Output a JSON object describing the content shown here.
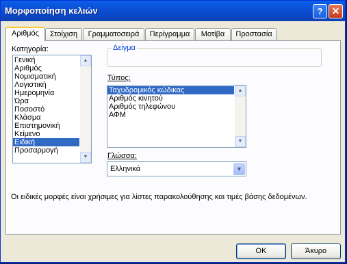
{
  "window": {
    "title": "Μορφοποίηση κελιών",
    "help_glyph": "?",
    "close_glyph": "✕"
  },
  "tabs": [
    {
      "label": "Αριθμός",
      "active": true
    },
    {
      "label": "Στοίχιση"
    },
    {
      "label": "Γραμματοσειρά"
    },
    {
      "label": "Περίγραμμα"
    },
    {
      "label": "Μοτίβα"
    },
    {
      "label": "Προστασία"
    }
  ],
  "category": {
    "label": "Κατηγορία:",
    "items": [
      "Γενική",
      "Αριθμός",
      "Νομισματική",
      "Λογιστική",
      "Ημερομηνία",
      "Ώρα",
      "Ποσοστό",
      "Κλάσμα",
      "Επιστημονική",
      "Κείμενο",
      "Ειδική",
      "Προσαρμογή"
    ],
    "selected_index": 10
  },
  "sample": {
    "legend": "Δείγμα"
  },
  "type": {
    "label": "Τύπος:",
    "items": [
      "Ταχυδρομικός κώδικας",
      "Αριθμός κινητού",
      "Αριθμός τηλεφώνου",
      "ΑΦΜ"
    ],
    "selected_index": 0
  },
  "language": {
    "label": "Γλώσσα:",
    "value": "Ελληνικά"
  },
  "description": "Οι ειδικές μορφές είναι χρήσιμες για λίστες παρακολούθησης και τιμές βάσης δεδομένων.",
  "buttons": {
    "ok": "OK",
    "cancel": "Άκυρο"
  },
  "colors": {
    "titlebar": "#0a5fe8",
    "selection": "#316ac5",
    "legend": "#0046d5"
  }
}
